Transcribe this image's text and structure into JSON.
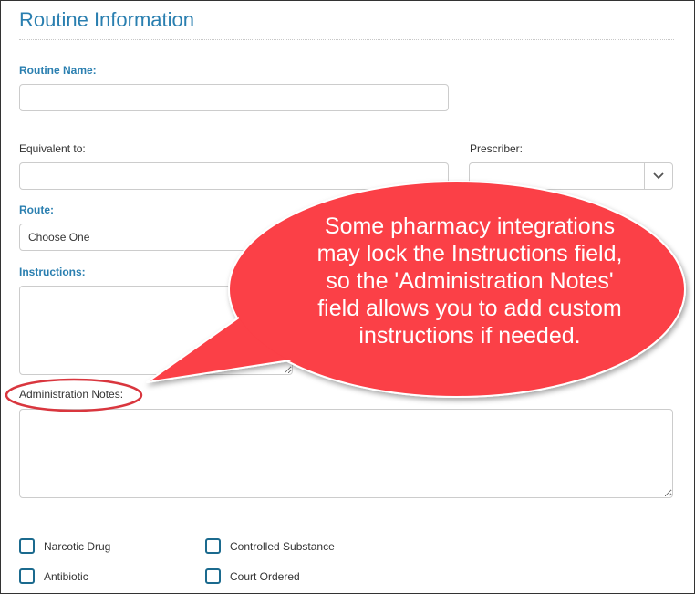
{
  "section": {
    "title": "Routine Information"
  },
  "fields": {
    "routine_name": {
      "label": "Routine Name:",
      "value": ""
    },
    "equivalent_to": {
      "label": "Equivalent to:",
      "value": ""
    },
    "prescriber": {
      "label": "Prescriber:",
      "value": ""
    },
    "route": {
      "label": "Route:",
      "selected": "Choose One"
    },
    "instructions": {
      "label": "Instructions:",
      "value": ""
    },
    "administration_notes": {
      "label": "Administration Notes:",
      "value": ""
    }
  },
  "checkboxes": [
    {
      "label": "Narcotic Drug",
      "checked": false
    },
    {
      "label": "Controlled Substance",
      "checked": false
    },
    {
      "label": "Antibiotic",
      "checked": false
    },
    {
      "label": "Court Ordered",
      "checked": false
    }
  ],
  "callout": {
    "lines": [
      "Some pharmacy integrations",
      "may lock the Instructions field,",
      "so the 'Administration Notes'",
      "field allows you to add custom",
      "instructions if needed."
    ],
    "fill": "#fb3f46"
  },
  "colors": {
    "accent": "#2a7fb0",
    "checkbox_border": "#1b6a8e",
    "callout": "#fb3f46"
  },
  "icons": {
    "select_arrow": "chevron-down-icon"
  }
}
